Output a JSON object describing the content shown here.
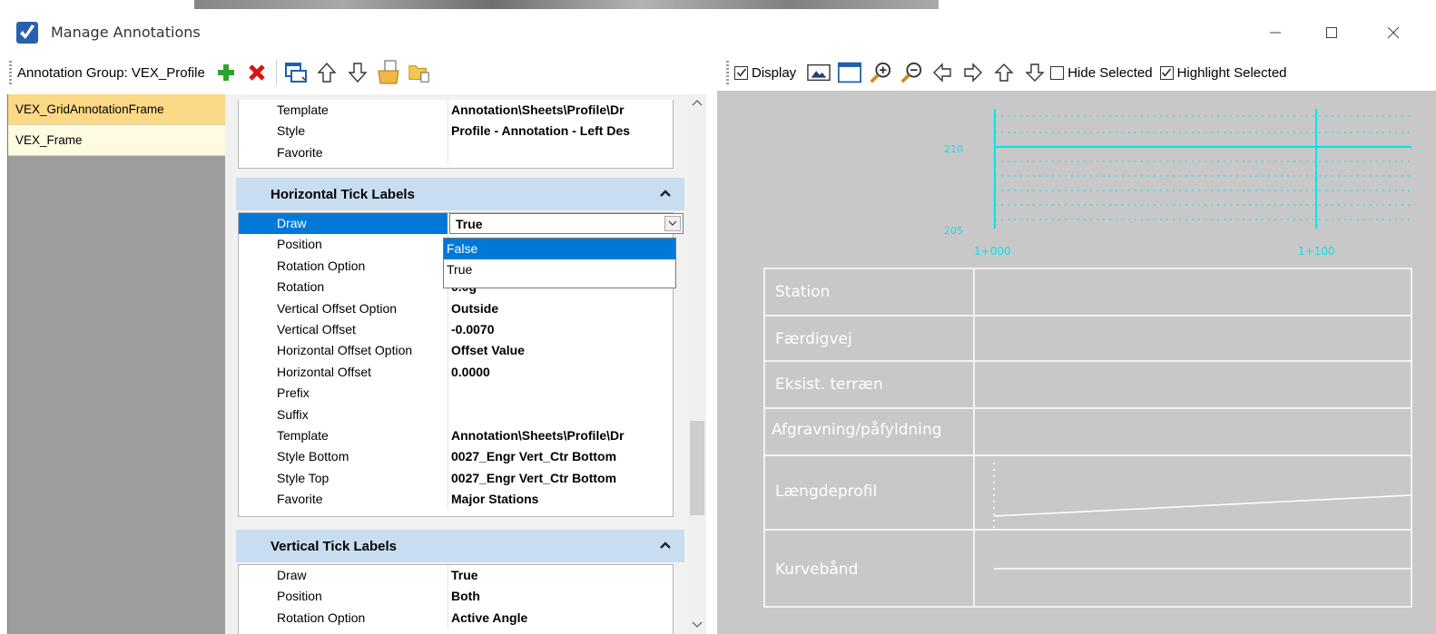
{
  "window": {
    "title": "Manage Annotations"
  },
  "toolbar": {
    "group_label": "Annotation Group: VEX_Profile",
    "display_label": "Display",
    "hide_selected_label": "Hide Selected",
    "highlight_selected_label": "Highlight Selected",
    "display_checked": true,
    "hide_selected_checked": false,
    "highlight_selected_checked": true
  },
  "annotation_list": [
    {
      "label": "VEX_GridAnnotationFrame",
      "selected": true
    },
    {
      "label": "VEX_Frame",
      "selected": false
    }
  ],
  "top_props": [
    {
      "key": "Template",
      "value": "Annotation\\Sheets\\Profile\\Dr"
    },
    {
      "key": "Style",
      "value": "Profile - Annotation - Left Des"
    },
    {
      "key": "Favorite",
      "value": ""
    }
  ],
  "horizontal_section": {
    "title": "Horizontal Tick Labels",
    "draw_key": "Draw",
    "draw_value": "True",
    "dropdown_options": [
      "False",
      "True"
    ],
    "highlighted_option": "False",
    "rows": [
      {
        "key": "Position",
        "value": ""
      },
      {
        "key": "Rotation Option",
        "value": ""
      },
      {
        "key": "Rotation",
        "value": "0.0g"
      },
      {
        "key": "Vertical Offset Option",
        "value": "Outside"
      },
      {
        "key": "Vertical Offset",
        "value": "-0.0070"
      },
      {
        "key": "Horizontal Offset Option",
        "value": "Offset Value"
      },
      {
        "key": "Horizontal Offset",
        "value": "0.0000"
      },
      {
        "key": "Prefix",
        "value": ""
      },
      {
        "key": "Suffix",
        "value": ""
      },
      {
        "key": "Template",
        "value": "Annotation\\Sheets\\Profile\\Dr"
      },
      {
        "key": "Style Bottom",
        "value": "0027_Engr Vert_Ctr Bottom"
      },
      {
        "key": "Style Top",
        "value": "0027_Engr Vert_Ctr Bottom"
      },
      {
        "key": "Favorite",
        "value": "Major Stations"
      }
    ]
  },
  "vertical_section": {
    "title": "Vertical Tick Labels",
    "rows": [
      {
        "key": "Draw",
        "value": "True"
      },
      {
        "key": "Position",
        "value": "Both"
      },
      {
        "key": "Rotation Option",
        "value": "Active Angle"
      }
    ]
  },
  "preview": {
    "y_labels": [
      "210",
      "205"
    ],
    "x_labels": [
      "1+000",
      "1+100"
    ],
    "band_labels": [
      "Station",
      "Færdigvej",
      "Eksist. terræn",
      "Afgravning/påfyldning",
      "Længdeprofil",
      "Kurvebånd"
    ],
    "grid_color": "#00e5ee",
    "background": "#c8c8c8"
  }
}
